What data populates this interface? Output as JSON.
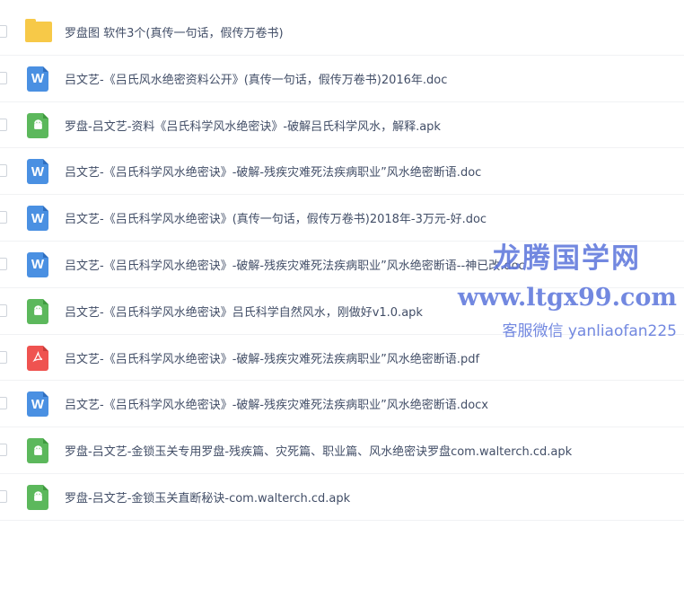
{
  "files": [
    {
      "name": "罗盘图 软件3个(真传一句话，假传万卷书)",
      "type": "folder",
      "icon": "folder-icon",
      "glyph": ""
    },
    {
      "name": "吕文艺-《吕氏风水绝密资料公开》(真传一句话，假传万卷书)2016年.doc",
      "type": "doc",
      "icon": "word-doc-icon",
      "glyph": "W"
    },
    {
      "name": "罗盘-吕文艺-资料《吕氏科学风水绝密诀》-破解吕氏科学风水，解释.apk",
      "type": "apk",
      "icon": "android-apk-icon",
      "glyph": "🤖"
    },
    {
      "name": "吕文艺-《吕氏科学风水绝密诀》-破解-残疾灾难死法疾病职业”风水绝密断语.doc",
      "type": "doc",
      "icon": "word-doc-icon",
      "glyph": "W"
    },
    {
      "name": "吕文艺-《吕氏科学风水绝密诀》(真传一句话，假传万卷书)2018年-3万元-好.doc",
      "type": "doc",
      "icon": "word-doc-icon",
      "glyph": "W"
    },
    {
      "name": "吕文艺-《吕氏科学风水绝密诀》-破解-残疾灾难死法疾病职业”风水绝密断语--神已改.doc",
      "type": "doc",
      "icon": "word-doc-icon",
      "glyph": "W"
    },
    {
      "name": "吕文艺-《吕氏科学风水绝密诀》吕氏科学自然风水，刚做好v1.0.apk",
      "type": "apk",
      "icon": "android-apk-icon",
      "glyph": "🤖"
    },
    {
      "name": "吕文艺-《吕氏科学风水绝密诀》-破解-残疾灾难死法疾病职业”风水绝密断语.pdf",
      "type": "pdf",
      "icon": "pdf-icon",
      "glyph": "ℐ"
    },
    {
      "name": "吕文艺-《吕氏科学风水绝密诀》-破解-残疾灾难死法疾病职业”风水绝密断语.docx",
      "type": "doc",
      "icon": "word-doc-icon",
      "glyph": "W"
    },
    {
      "name": "罗盘-吕文艺-金锁玉关专用罗盘-残疾篇、灾死篇、职业篇、风水绝密诀罗盘com.walterch.cd.apk",
      "type": "apk",
      "icon": "android-apk-icon",
      "glyph": "🤖"
    },
    {
      "name": "罗盘-吕文艺-金锁玉关直断秘诀-com.walterch.cd.apk",
      "type": "apk",
      "icon": "android-apk-icon",
      "glyph": "🤖"
    }
  ],
  "watermark": {
    "title": "龙腾国学网",
    "url": "www.ltgx99.com",
    "service": "客服微信 yanliaofan225"
  },
  "colors": {
    "folder": "#f7c948",
    "doc": "#4a90e2",
    "apk": "#5cb85c",
    "pdf": "#ef5350",
    "text": "#424e67",
    "watermark": "#5e78dc"
  }
}
